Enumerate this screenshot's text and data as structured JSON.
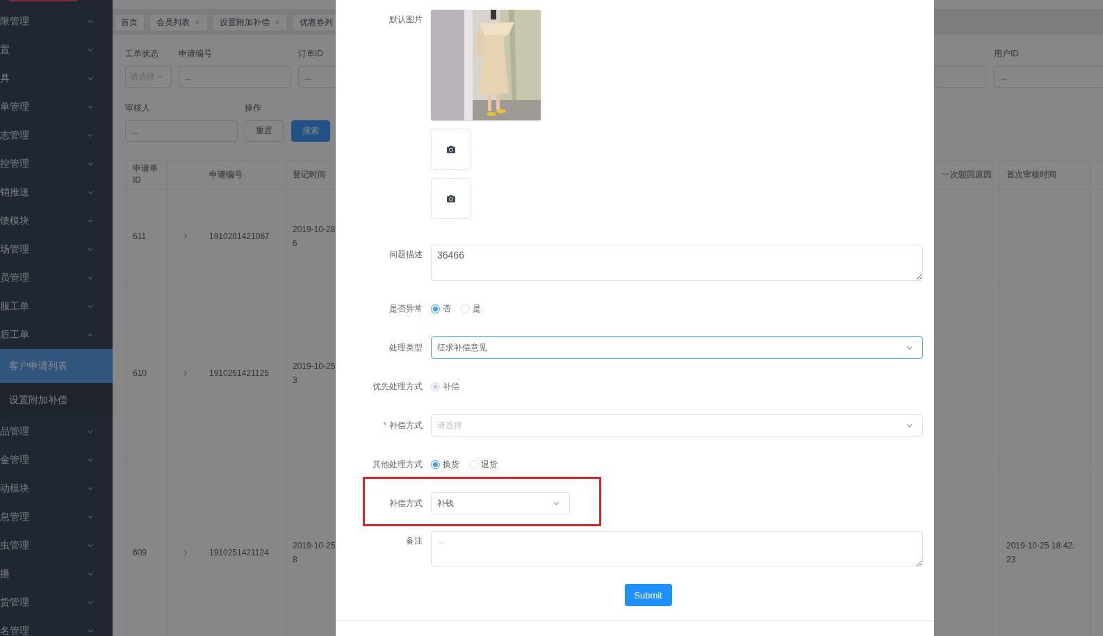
{
  "sidebar": {
    "items": [
      {
        "label": "限管理",
        "expanded": false
      },
      {
        "label": "置",
        "expanded": false
      },
      {
        "label": "具",
        "expanded": false
      },
      {
        "label": "单管理",
        "expanded": false
      },
      {
        "label": "志管理",
        "expanded": false
      },
      {
        "label": "控管理",
        "expanded": false
      },
      {
        "label": "销推送",
        "expanded": false
      },
      {
        "label": "馈模块",
        "expanded": false
      },
      {
        "label": "场管理",
        "expanded": false
      },
      {
        "label": "员管理",
        "expanded": false
      },
      {
        "label": "服工单",
        "expanded": false
      },
      {
        "label": "后工单",
        "expanded": true,
        "children": [
          {
            "label": "客户申请列表",
            "selected": true
          },
          {
            "label": "设置附加补偿",
            "selected": false
          }
        ]
      },
      {
        "label": "品管理",
        "expanded": false
      },
      {
        "label": "金管理",
        "expanded": false
      },
      {
        "label": "动模块",
        "expanded": false
      },
      {
        "label": "息管理",
        "expanded": false
      },
      {
        "label": "虫管理",
        "expanded": false
      },
      {
        "label": "播",
        "expanded": false
      },
      {
        "label": "货管理",
        "expanded": false
      },
      {
        "label": "名管理",
        "expanded": false
      }
    ]
  },
  "tabs": [
    {
      "label": "首页",
      "closable": false
    },
    {
      "label": "会员列表",
      "closable": true
    },
    {
      "label": "设置附加补偿",
      "closable": true
    },
    {
      "label": "优惠券列",
      "closable": false
    }
  ],
  "filters": {
    "row_1": [
      {
        "label": "工单状态",
        "kind": "select",
        "placeholder": "请选择"
      },
      {
        "label": "申请编号",
        "kind": "input",
        "placeholder": "..."
      },
      {
        "label": "订单ID",
        "kind": "input",
        "placeholder": "..."
      }
    ],
    "row_2": [
      {
        "label": "审核人",
        "kind": "input",
        "placeholder": "..."
      }
    ],
    "actions": {
      "label": "操作",
      "buttons": [
        {
          "label": "重置",
          "primary": false
        },
        {
          "label": "搜索",
          "primary": true
        }
      ]
    },
    "right": [
      {
        "kind": "input"
      },
      {
        "label": "用户ID",
        "kind": "input",
        "placeholder": "..."
      }
    ]
  },
  "table": {
    "columns": {
      "id": "申请单\nID",
      "number": "申请编号",
      "registered": "登记时间",
      "reject_reason": "一次驳回原因",
      "first_review_time": "首次审核时间"
    },
    "rows": [
      {
        "id": "611",
        "expandable": true,
        "number": "1910281421067",
        "registered": "2019-10-28\n6"
      },
      {
        "id": "610",
        "expandable": true,
        "number": "1910251421125",
        "registered": "2019-10-25\n3"
      },
      {
        "id": "609",
        "expandable": true,
        "number": "1910251421124",
        "registered": "2019-10-25\n8",
        "first_review_time": "2019-10-25 18:42:\n23"
      }
    ]
  },
  "dialog": {
    "form": [
      {
        "kind": "images",
        "label": "默认图片",
        "slots": [
          {
            "kind": "picture"
          },
          {
            "kind": "upload"
          },
          {
            "kind": "upload"
          }
        ]
      },
      {
        "kind": "textarea",
        "label": "问题描述",
        "value": "36466"
      },
      {
        "kind": "radio",
        "label": "是否异常",
        "options": [
          {
            "label": "否",
            "selected": true,
            "disabled": false
          },
          {
            "label": "是",
            "selected": false,
            "disabled": false
          }
        ]
      },
      {
        "kind": "select",
        "label": "处理类型",
        "value": "征求补偿意见",
        "focused": true,
        "wide": true
      },
      {
        "kind": "radio",
        "label": "优先处理方式",
        "options": [
          {
            "label": "补偿",
            "selected": true,
            "disabled": true
          }
        ]
      },
      {
        "kind": "select",
        "label": "补偿方式",
        "required_mark": "*",
        "placeholder": "请选择",
        "focused": false,
        "wide": true
      },
      {
        "kind": "radio",
        "label": "其他处理方式",
        "options": [
          {
            "label": "换货",
            "selected": true,
            "disabled": false
          },
          {
            "label": "退货",
            "selected": false,
            "disabled": false
          }
        ]
      },
      {
        "kind": "select",
        "label": "补偿方式",
        "value": "补钱",
        "focused": false,
        "wide": false,
        "highlighted": true
      },
      {
        "kind": "textarea",
        "label": "备注",
        "placeholder": "..."
      }
    ],
    "submit": "Submit"
  }
}
